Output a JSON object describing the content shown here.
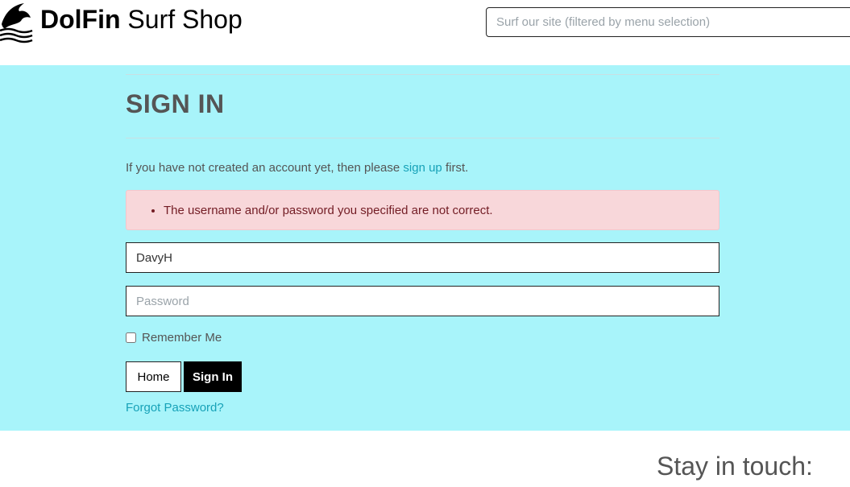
{
  "header": {
    "brand_bold": "DolFin",
    "brand_rest": " Surf Shop",
    "logo_icon": "dolphin-logo-icon",
    "search_placeholder": "Surf our site (filtered by menu selection)"
  },
  "signin": {
    "title": "SIGN IN",
    "intro_before": "If you have not created an account yet, then please ",
    "intro_link": "sign up",
    "intro_after": " first.",
    "error_message": "The username and/or password you specified are not correct.",
    "username_value": "DavyH",
    "password_placeholder": "Password",
    "remember_label": "Remember Me",
    "home_button": "Home",
    "signin_button": "Sign In",
    "forgot_link": "Forgot Password?"
  },
  "footer": {
    "stay_in_touch": "Stay in touch:"
  },
  "colors": {
    "main_bg": "#a8f4fa",
    "link": "#17a2b8",
    "alert_bg": "#f8d7da",
    "alert_text": "#721c24"
  }
}
